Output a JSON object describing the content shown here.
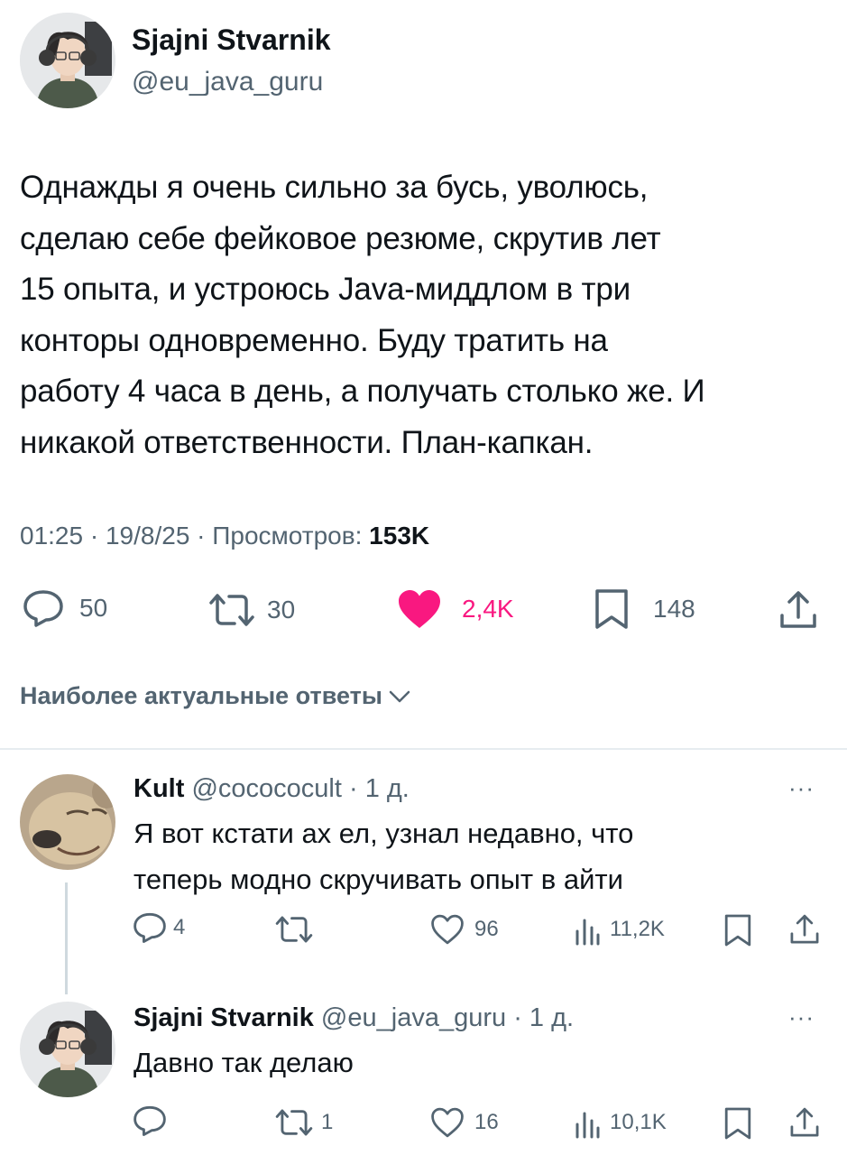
{
  "main_tweet": {
    "author_name": "Sjajni Stvarnik",
    "author_handle": "@eu_java_guru",
    "text_lines": [
      "Однажды я очень сильно за бусь, уволюсь,",
      "сделаю себе фейковое резюме, скрутив лет",
      "15 опыта, и устроюсь Java-миддлом в три",
      "конторы одновременно. Буду тратить на",
      "работу 4 часа в день, а получать столько же. И",
      "никакой ответственности. План-капкан."
    ],
    "meta": {
      "time": "01:25",
      "date": "19/8/25",
      "views_label": "Просмотров:",
      "views_count": "153K",
      "separator": "·"
    },
    "actions": {
      "replies": "50",
      "retweets": "30",
      "likes": "2,4K",
      "bookmarks": "148"
    }
  },
  "replies_header": {
    "label": "Наиболее актуальные ответы"
  },
  "replies": [
    {
      "author_name": "Kult",
      "author_handle": "@cocococult",
      "time": "1 д.",
      "separator": "·",
      "text_lines": [
        "Я вот кстати ах ел, узнал недавно, что",
        "теперь модно скручивать опыт в айти"
      ],
      "more": "···",
      "actions": {
        "replies": "4",
        "retweets": "",
        "likes": "96",
        "views": "11,2K"
      }
    },
    {
      "author_name": "Sjajni Stvarnik",
      "author_handle": "@eu_java_guru",
      "time": "1 д.",
      "separator": "·",
      "text_lines": [
        "Давно так делаю"
      ],
      "more": "···",
      "actions": {
        "replies": "",
        "retweets": "1",
        "likes": "16",
        "views": "10,1K"
      }
    }
  ],
  "colors": {
    "text": "#0f1419",
    "muted": "#536471",
    "like_active": "#f91880",
    "border": "#eff3f4",
    "thread_line": "#cfd9de"
  },
  "icons": {
    "reply": "reply-icon",
    "retweet": "retweet-icon",
    "like": "heart-icon",
    "bookmark": "bookmark-icon",
    "share": "share-icon",
    "views": "views-icon",
    "more": "more-icon",
    "chevron": "chevron-down-icon"
  }
}
